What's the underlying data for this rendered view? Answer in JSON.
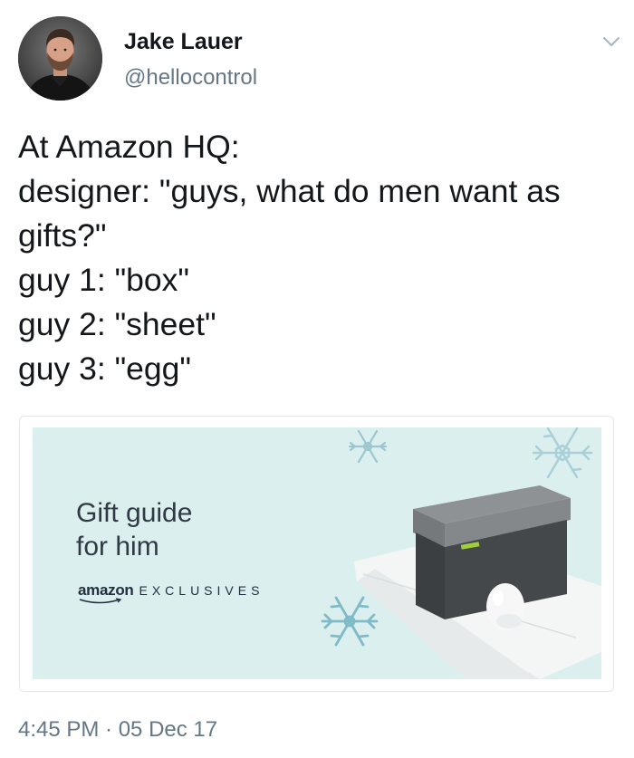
{
  "author": {
    "display_name": "Jake Lauer",
    "handle": "@hellocontrol"
  },
  "tweet": {
    "lines": [
      "At Amazon HQ:",
      "designer: \"guys, what do men want as",
      "gifts?\"",
      "guy 1: \"box\"",
      "guy 2: \"sheet\"",
      "guy 3: \"egg\""
    ],
    "timestamp": "4:45 PM · 05 Dec 17"
  },
  "card": {
    "headline_line1": "Gift guide",
    "headline_line2": "for him",
    "brand": "amazon",
    "brand_suffix": "EXCLUSIVES",
    "product_tag": "Amazon",
    "background_color": "#dcefef"
  },
  "icons": {
    "menu": "chevron-down-icon",
    "decoration": "snowflake-icon"
  },
  "colors": {
    "text_primary": "#14171a",
    "text_secondary": "#657786",
    "card_border": "#e1e8ed"
  }
}
